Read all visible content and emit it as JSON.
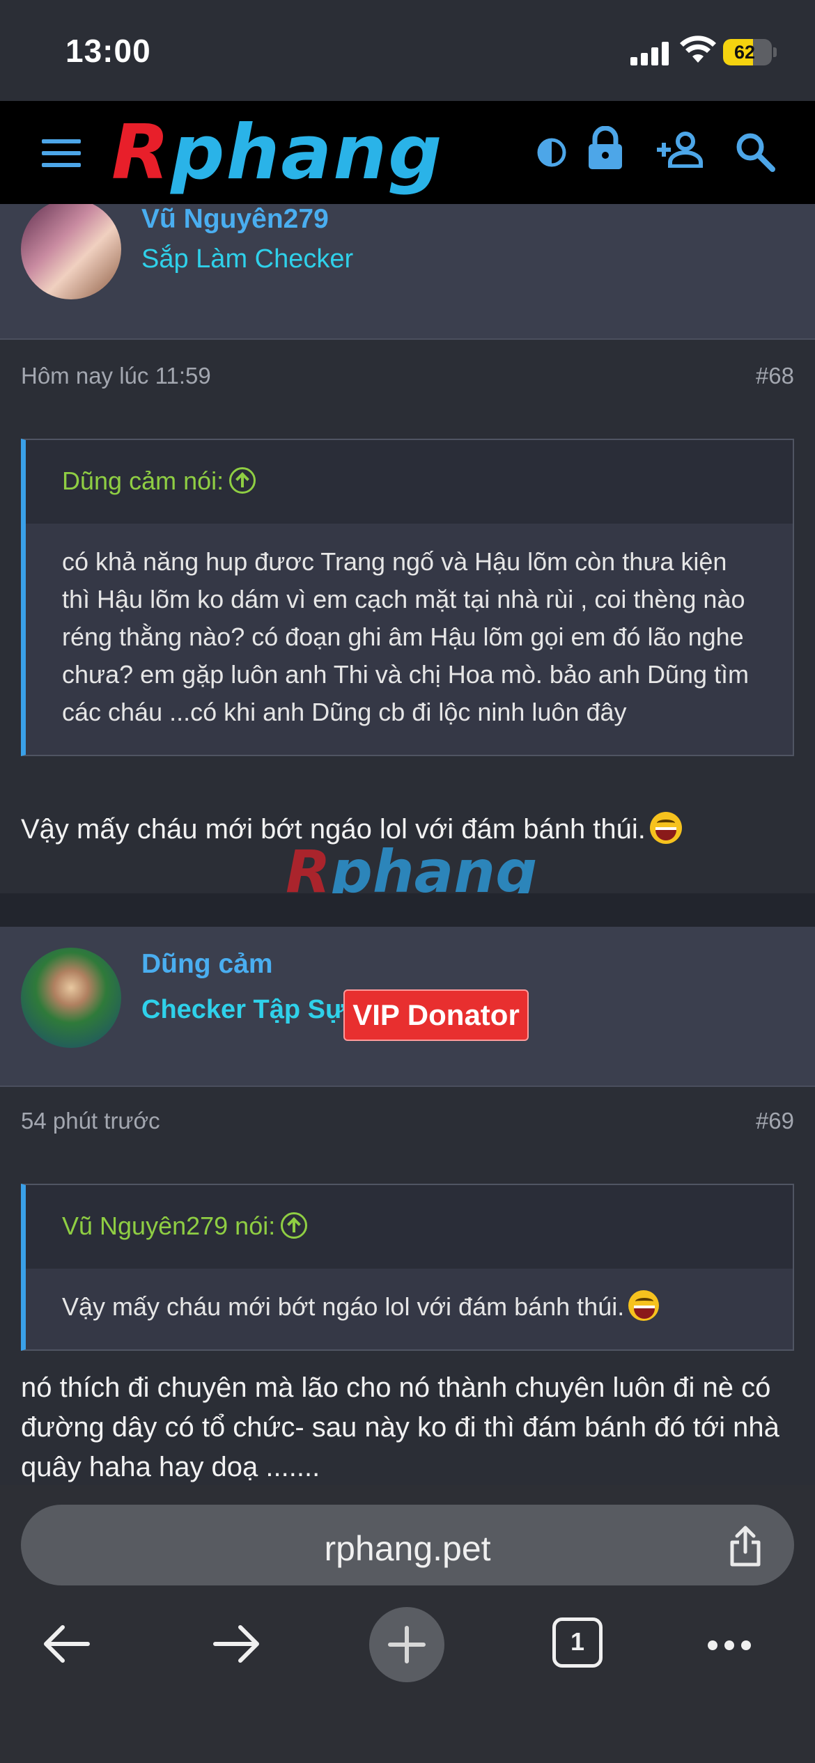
{
  "status_bar": {
    "time": "13:00",
    "battery_percent": "62",
    "battery_level": 0.62
  },
  "header": {
    "logo_text": "Rphang"
  },
  "posts": [
    {
      "username": "Vũ Nguyên279",
      "user_title": "Sắp Làm Checker",
      "time": "Hôm nay lúc 11:59",
      "number": "#68",
      "quote_author": "Dũng cảm nói:",
      "quote_text": "có khả năng hup đươc Trang ngố và Hậu lõm còn thưa kiện thì Hậu lõm ko dám vì em cạch mặt tại nhà rùi , coi thèng nào réng thằng nào? có đoạn ghi âm Hậu lõm gọi em đó lão nghe chưa? em gặp luôn anh Thi và chị Hoa mò. bảo anh Dũng tìm các cháu ...có khi anh Dũng cb đi lộc ninh luôn đây",
      "body": "Vậy mấy cháu mới bớt ngáo lol với đám bánh thúi."
    },
    {
      "username": "Dũng cảm",
      "user_title": "Checker Tập Sự",
      "badge": "VIP Donator",
      "time": "54 phút trước",
      "number": "#69",
      "quote_author": "Vũ Nguyên279 nói:",
      "quote_text": "Vậy mấy cháu mới bớt ngáo lol với đám bánh thúi.",
      "body": "nó thích đi chuyên mà lão cho nó thành chuyên luôn đi nè có đường dây có tổ chức- sau này ko đi thì đám bánh đó tới nhà quây haha hay doạ ......."
    }
  ],
  "watermark": "Rphang",
  "browser": {
    "url": "rphang.pet",
    "tab_count": "1"
  },
  "colors": {
    "accent": "#4aaef0",
    "title": "#2fd1ea",
    "quote_author": "#8fce43",
    "vip": "#e82f2f"
  }
}
